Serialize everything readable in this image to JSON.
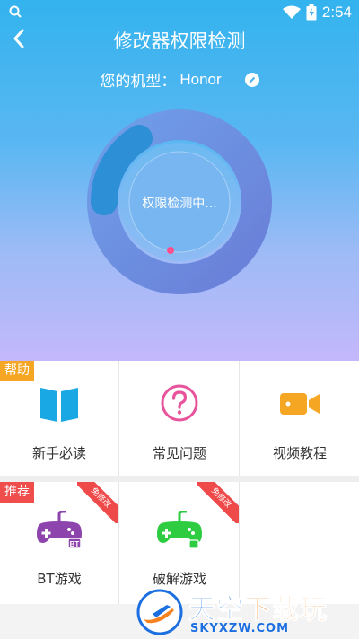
{
  "status_bar": {
    "time": "2:54",
    "icons": [
      "search-icon",
      "wifi-icon",
      "battery-charging-icon"
    ]
  },
  "header": {
    "title": "修改器权限检测",
    "back_icon": "chevron-left-icon"
  },
  "model": {
    "label": "您的机型：",
    "value": "Honor",
    "edit_icon": "pencil-icon"
  },
  "scan": {
    "status_text": "权限检测中..."
  },
  "help_section": {
    "tag": "帮助",
    "items": [
      {
        "label": "新手必读",
        "icon": "book-icon",
        "color": "#1aa8e4"
      },
      {
        "label": "常见问题",
        "icon": "question-icon",
        "color": "#e8549c"
      },
      {
        "label": "视频教程",
        "icon": "video-camera-icon",
        "color": "#f5a623"
      }
    ]
  },
  "recommend_section": {
    "tag": "推荐",
    "items": [
      {
        "label": "BT游戏",
        "icon": "gamepad-bt-icon",
        "color": "#8e44ad",
        "ribbon": "免修改",
        "badge": "BT"
      },
      {
        "label": "破解游戏",
        "icon": "gamepad-lock-icon",
        "color": "#2ecc40",
        "ribbon": "免修改"
      }
    ]
  },
  "watermark": {
    "main_a": "天空",
    "main_b": "下载玩",
    "sub": "SKYXZW.COM"
  },
  "colors": {
    "accent_orange": "#f5a623",
    "accent_red": "#f04d4d",
    "brand_blue": "#1b6fe0"
  }
}
